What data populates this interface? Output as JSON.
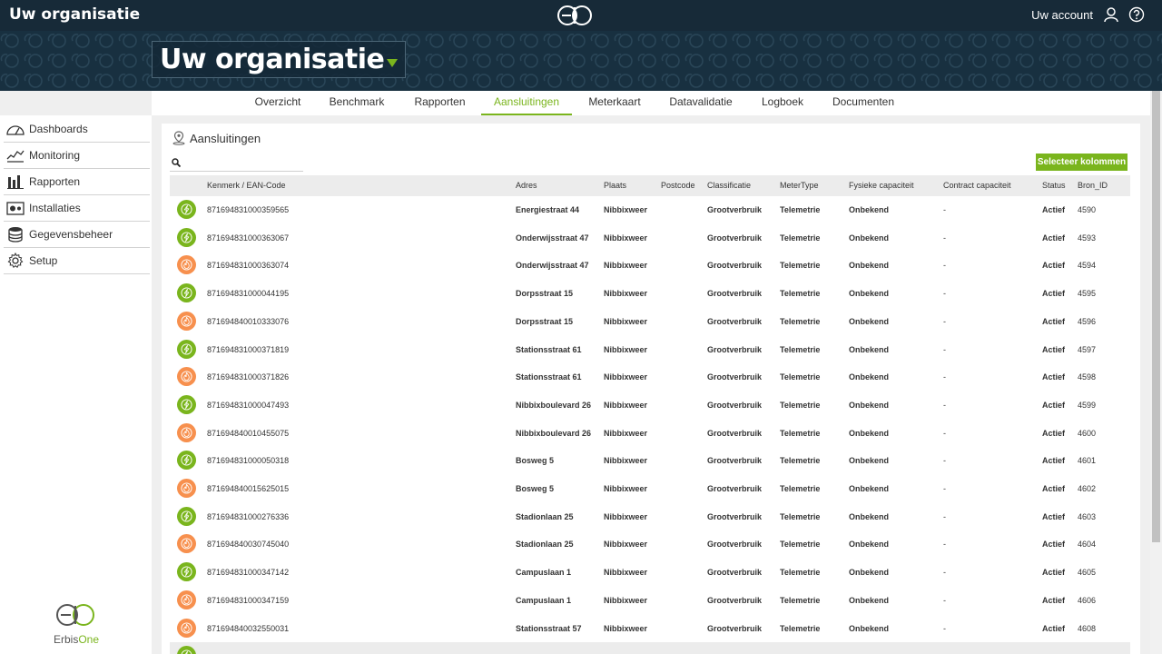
{
  "app": {
    "title": "Uw organisatie",
    "logo_icon": "erbisone-logo-icon"
  },
  "account": {
    "label": "Uw account",
    "user_icon": "user-icon",
    "help_icon": "help-icon"
  },
  "organization": {
    "name": "Uw organisatie"
  },
  "tabs": [
    {
      "label": "Overzicht",
      "active": false
    },
    {
      "label": "Benchmark",
      "active": false
    },
    {
      "label": "Rapporten",
      "active": false
    },
    {
      "label": "Aansluitingen",
      "active": true
    },
    {
      "label": "Meterkaart",
      "active": false
    },
    {
      "label": "Datavalidatie",
      "active": false
    },
    {
      "label": "Logboek",
      "active": false
    },
    {
      "label": "Documenten",
      "active": false
    }
  ],
  "sidebar": {
    "items": [
      {
        "label": "Dashboards",
        "icon": "gauge-icon"
      },
      {
        "label": "Monitoring",
        "icon": "monitoring-icon"
      },
      {
        "label": "Rapporten",
        "icon": "bar-chart-icon"
      },
      {
        "label": "Installaties",
        "icon": "installations-icon"
      },
      {
        "label": "Gegevensbeheer",
        "icon": "database-icon"
      },
      {
        "label": "Setup",
        "icon": "gear-icon"
      }
    ],
    "brand": {
      "part1": "Erbis",
      "part2": "One"
    }
  },
  "panel": {
    "title": "Aansluitingen",
    "search_placeholder": "",
    "select_columns_label": "Selecteer kolommen"
  },
  "table": {
    "columns": [
      "Kenmerk / EAN-Code",
      "Adres",
      "Plaats",
      "Postcode",
      "Classificatie",
      "MeterType",
      "Fysieke capaciteit",
      "Contract capaciteit",
      "Status",
      "Bron_ID"
    ],
    "rows": [
      {
        "type": "elec",
        "ean": "871694831000359565",
        "adres": "Energiestraat 44",
        "plaats": "Nibbixweer",
        "postcode": "",
        "classificatie": "Grootverbruik",
        "metertype": "Telemetrie",
        "fysiek": "Onbekend",
        "contract": "-",
        "status": "Actief",
        "bron": "4590"
      },
      {
        "type": "elec",
        "ean": "871694831000363067",
        "adres": "Onderwijsstraat 47",
        "plaats": "Nibbixweer",
        "postcode": "",
        "classificatie": "Grootverbruik",
        "metertype": "Telemetrie",
        "fysiek": "Onbekend",
        "contract": "-",
        "status": "Actief",
        "bron": "4593"
      },
      {
        "type": "gas",
        "ean": "871694831000363074",
        "adres": "Onderwijsstraat 47",
        "plaats": "Nibbixweer",
        "postcode": "",
        "classificatie": "Grootverbruik",
        "metertype": "Telemetrie",
        "fysiek": "Onbekend",
        "contract": "-",
        "status": "Actief",
        "bron": "4594"
      },
      {
        "type": "elec",
        "ean": "871694831000044195",
        "adres": "Dorpsstraat 15",
        "plaats": "Nibbixweer",
        "postcode": "",
        "classificatie": "Grootverbruik",
        "metertype": "Telemetrie",
        "fysiek": "Onbekend",
        "contract": "-",
        "status": "Actief",
        "bron": "4595"
      },
      {
        "type": "gas",
        "ean": "871694840010333076",
        "adres": "Dorpsstraat 15",
        "plaats": "Nibbixweer",
        "postcode": "",
        "classificatie": "Grootverbruik",
        "metertype": "Telemetrie",
        "fysiek": "Onbekend",
        "contract": "-",
        "status": "Actief",
        "bron": "4596"
      },
      {
        "type": "elec",
        "ean": "871694831000371819",
        "adres": "Stationsstraat 61",
        "plaats": "Nibbixweer",
        "postcode": "",
        "classificatie": "Grootverbruik",
        "metertype": "Telemetrie",
        "fysiek": "Onbekend",
        "contract": "-",
        "status": "Actief",
        "bron": "4597"
      },
      {
        "type": "gas",
        "ean": "871694831000371826",
        "adres": "Stationsstraat 61",
        "plaats": "Nibbixweer",
        "postcode": "",
        "classificatie": "Grootverbruik",
        "metertype": "Telemetrie",
        "fysiek": "Onbekend",
        "contract": "-",
        "status": "Actief",
        "bron": "4598"
      },
      {
        "type": "elec",
        "ean": "871694831000047493",
        "adres": "Nibbixboulevard 26",
        "plaats": "Nibbixweer",
        "postcode": "",
        "classificatie": "Grootverbruik",
        "metertype": "Telemetrie",
        "fysiek": "Onbekend",
        "contract": "-",
        "status": "Actief",
        "bron": "4599"
      },
      {
        "type": "gas",
        "ean": "871694840010455075",
        "adres": "Nibbixboulevard 26",
        "plaats": "Nibbixweer",
        "postcode": "",
        "classificatie": "Grootverbruik",
        "metertype": "Telemetrie",
        "fysiek": "Onbekend",
        "contract": "-",
        "status": "Actief",
        "bron": "4600"
      },
      {
        "type": "elec",
        "ean": "871694831000050318",
        "adres": "Bosweg 5",
        "plaats": "Nibbixweer",
        "postcode": "",
        "classificatie": "Grootverbruik",
        "metertype": "Telemetrie",
        "fysiek": "Onbekend",
        "contract": "-",
        "status": "Actief",
        "bron": "4601"
      },
      {
        "type": "gas",
        "ean": "871694840015625015",
        "adres": "Bosweg 5",
        "plaats": "Nibbixweer",
        "postcode": "",
        "classificatie": "Grootverbruik",
        "metertype": "Telemetrie",
        "fysiek": "Onbekend",
        "contract": "-",
        "status": "Actief",
        "bron": "4602"
      },
      {
        "type": "elec",
        "ean": "871694831000276336",
        "adres": "Stadionlaan 25",
        "plaats": "Nibbixweer",
        "postcode": "",
        "classificatie": "Grootverbruik",
        "metertype": "Telemetrie",
        "fysiek": "Onbekend",
        "contract": "-",
        "status": "Actief",
        "bron": "4603"
      },
      {
        "type": "gas",
        "ean": "871694840030745040",
        "adres": "Stadionlaan 25",
        "plaats": "Nibbixweer",
        "postcode": "",
        "classificatie": "Grootverbruik",
        "metertype": "Telemetrie",
        "fysiek": "Onbekend",
        "contract": "-",
        "status": "Actief",
        "bron": "4604"
      },
      {
        "type": "elec",
        "ean": "871694831000347142",
        "adres": "Campuslaan 1",
        "plaats": "Nibbixweer",
        "postcode": "",
        "classificatie": "Grootverbruik",
        "metertype": "Telemetrie",
        "fysiek": "Onbekend",
        "contract": "-",
        "status": "Actief",
        "bron": "4605"
      },
      {
        "type": "gas",
        "ean": "871694831000347159",
        "adres": "Campuslaan 1",
        "plaats": "Nibbixweer",
        "postcode": "",
        "classificatie": "Grootverbruik",
        "metertype": "Telemetrie",
        "fysiek": "Onbekend",
        "contract": "-",
        "status": "Actief",
        "bron": "4606"
      },
      {
        "type": "gas",
        "ean": "871694840032550031",
        "adres": "Stationsstraat 57",
        "plaats": "Nibbixweer",
        "postcode": "",
        "classificatie": "Grootverbruik",
        "metertype": "Telemetrie",
        "fysiek": "Onbekend",
        "contract": "-",
        "status": "Actief",
        "bron": "4608"
      },
      {
        "type": "elec",
        "ean": "",
        "adres": "",
        "plaats": "",
        "postcode": "",
        "classificatie": "",
        "metertype": "",
        "fysiek": "",
        "contract": "",
        "status": "",
        "bron": ""
      }
    ]
  },
  "colors": {
    "accent": "#7ab51d",
    "gas": "#f7904e",
    "header": "#183040"
  }
}
